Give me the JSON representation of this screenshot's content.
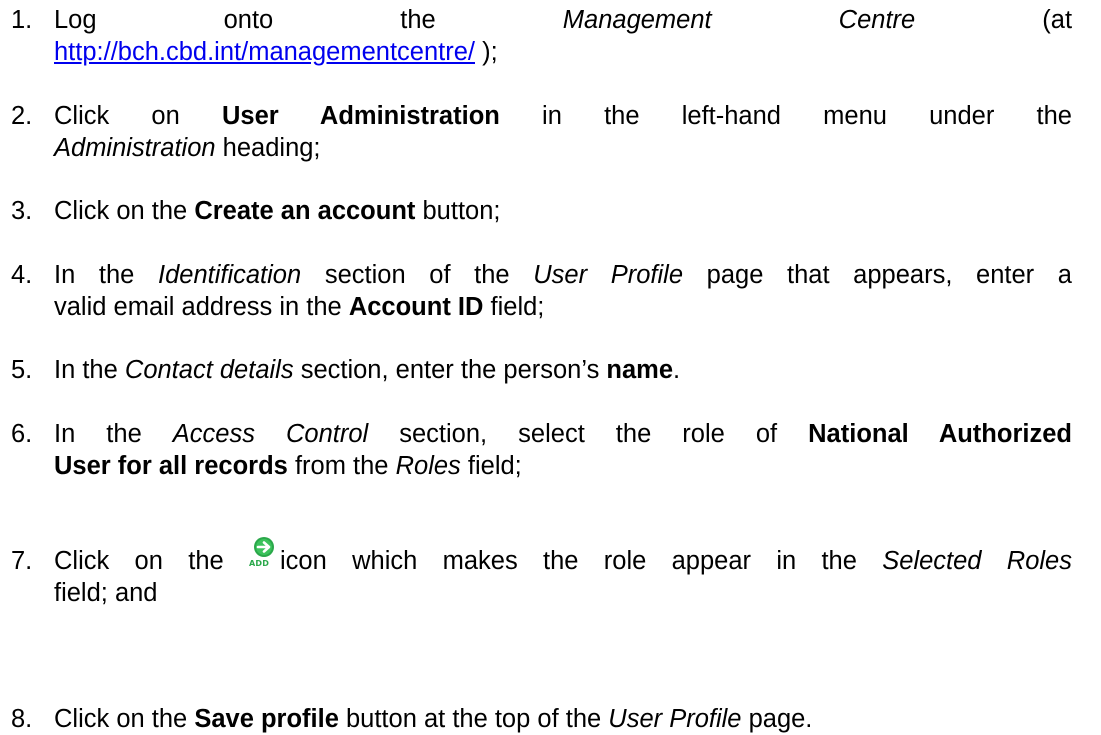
{
  "steps": [
    {
      "number": "1.",
      "log": "Log",
      "onto": "onto",
      "the": "the",
      "management_centre": "Management",
      "centre": "Centre",
      "at": "(at",
      "url": "http://bch.cbd.int/managementcentre/",
      "closing": ");"
    },
    {
      "number": "2.",
      "click_on": "Click on",
      "user_administration": "User Administration",
      "mid": "in the left-hand menu under the",
      "administration": "Administration",
      "heading": "heading;"
    },
    {
      "number": "3.",
      "click_on": "Click on the",
      "create_account": "Create an account",
      "button": "button;"
    },
    {
      "number": "4.",
      "in_the": "In the",
      "identification": "Identification",
      "section_of": "section of the",
      "user_profile": "User Profile",
      "page_appears": "page that appears, enter a",
      "valid_email": "valid email address in the",
      "account_id": "Account ID",
      "field": "field;"
    },
    {
      "number": "5.",
      "in_the": "In the",
      "contact_details": "Contact details",
      "section_enter": "section, enter the person’s",
      "name": "name",
      "period": "."
    },
    {
      "number": "6.",
      "in_the": "In the",
      "access_control": "Access Control",
      "section_select": "section, select the role of",
      "national_authorized": "National Authorized",
      "user_all_records": "User for all records",
      "from_the": "from the",
      "roles": "Roles",
      "field": "field;"
    },
    {
      "number": "7.",
      "click_on": "Click on the",
      "icon_label": "ADD",
      "icon_rest": "icon which makes the role appear in the",
      "selected_roles": "Selected Roles",
      "field_and": "field; and"
    },
    {
      "number": "8.",
      "click_on": "Click on the",
      "save_profile": "Save profile",
      "top_of": "button at the top of the",
      "user_profile": "User Profile",
      "page": "page."
    }
  ],
  "colors": {
    "link": "#0000ee",
    "add_icon_circle": "#2aa84a",
    "text": "#000000"
  }
}
